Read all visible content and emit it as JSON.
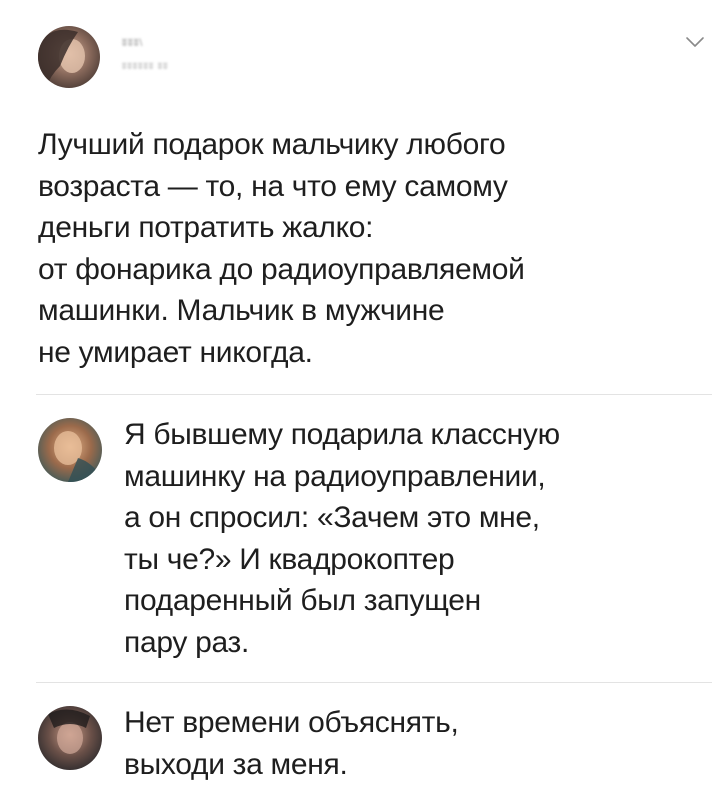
{
  "post": {
    "author_name": "ʬʬʬ\\",
    "author_handle": "ʬʬʬʬʬʬ ʬʬ",
    "avatar_icon": "user-avatar-icon",
    "menu_icon": "chevron-down-icon",
    "text": "Лучший подарок мальчику любого\nвозраста — то, на что ему самому\nденьги потратить жалко:\nот фонарика до радиоуправляемой\nмашинки. Мальчик в мужчине\nне умирает никогда."
  },
  "replies": [
    {
      "avatar_icon": "user-avatar-icon",
      "text": "Я бывшему подарила классную\nмашинку на радиоуправлении,\nа он спросил: «Зачем это мне,\nты че?» И квадрокоптер\nподаренный был запущен\nпару раз."
    },
    {
      "avatar_icon": "user-avatar-icon",
      "text": "Нет времени объяснять,\nвыходи за меня."
    }
  ],
  "colors": {
    "text": "#1e1e1e",
    "divider": "#e3e3e3",
    "muted": "#9a9a9a",
    "background": "#ffffff"
  }
}
